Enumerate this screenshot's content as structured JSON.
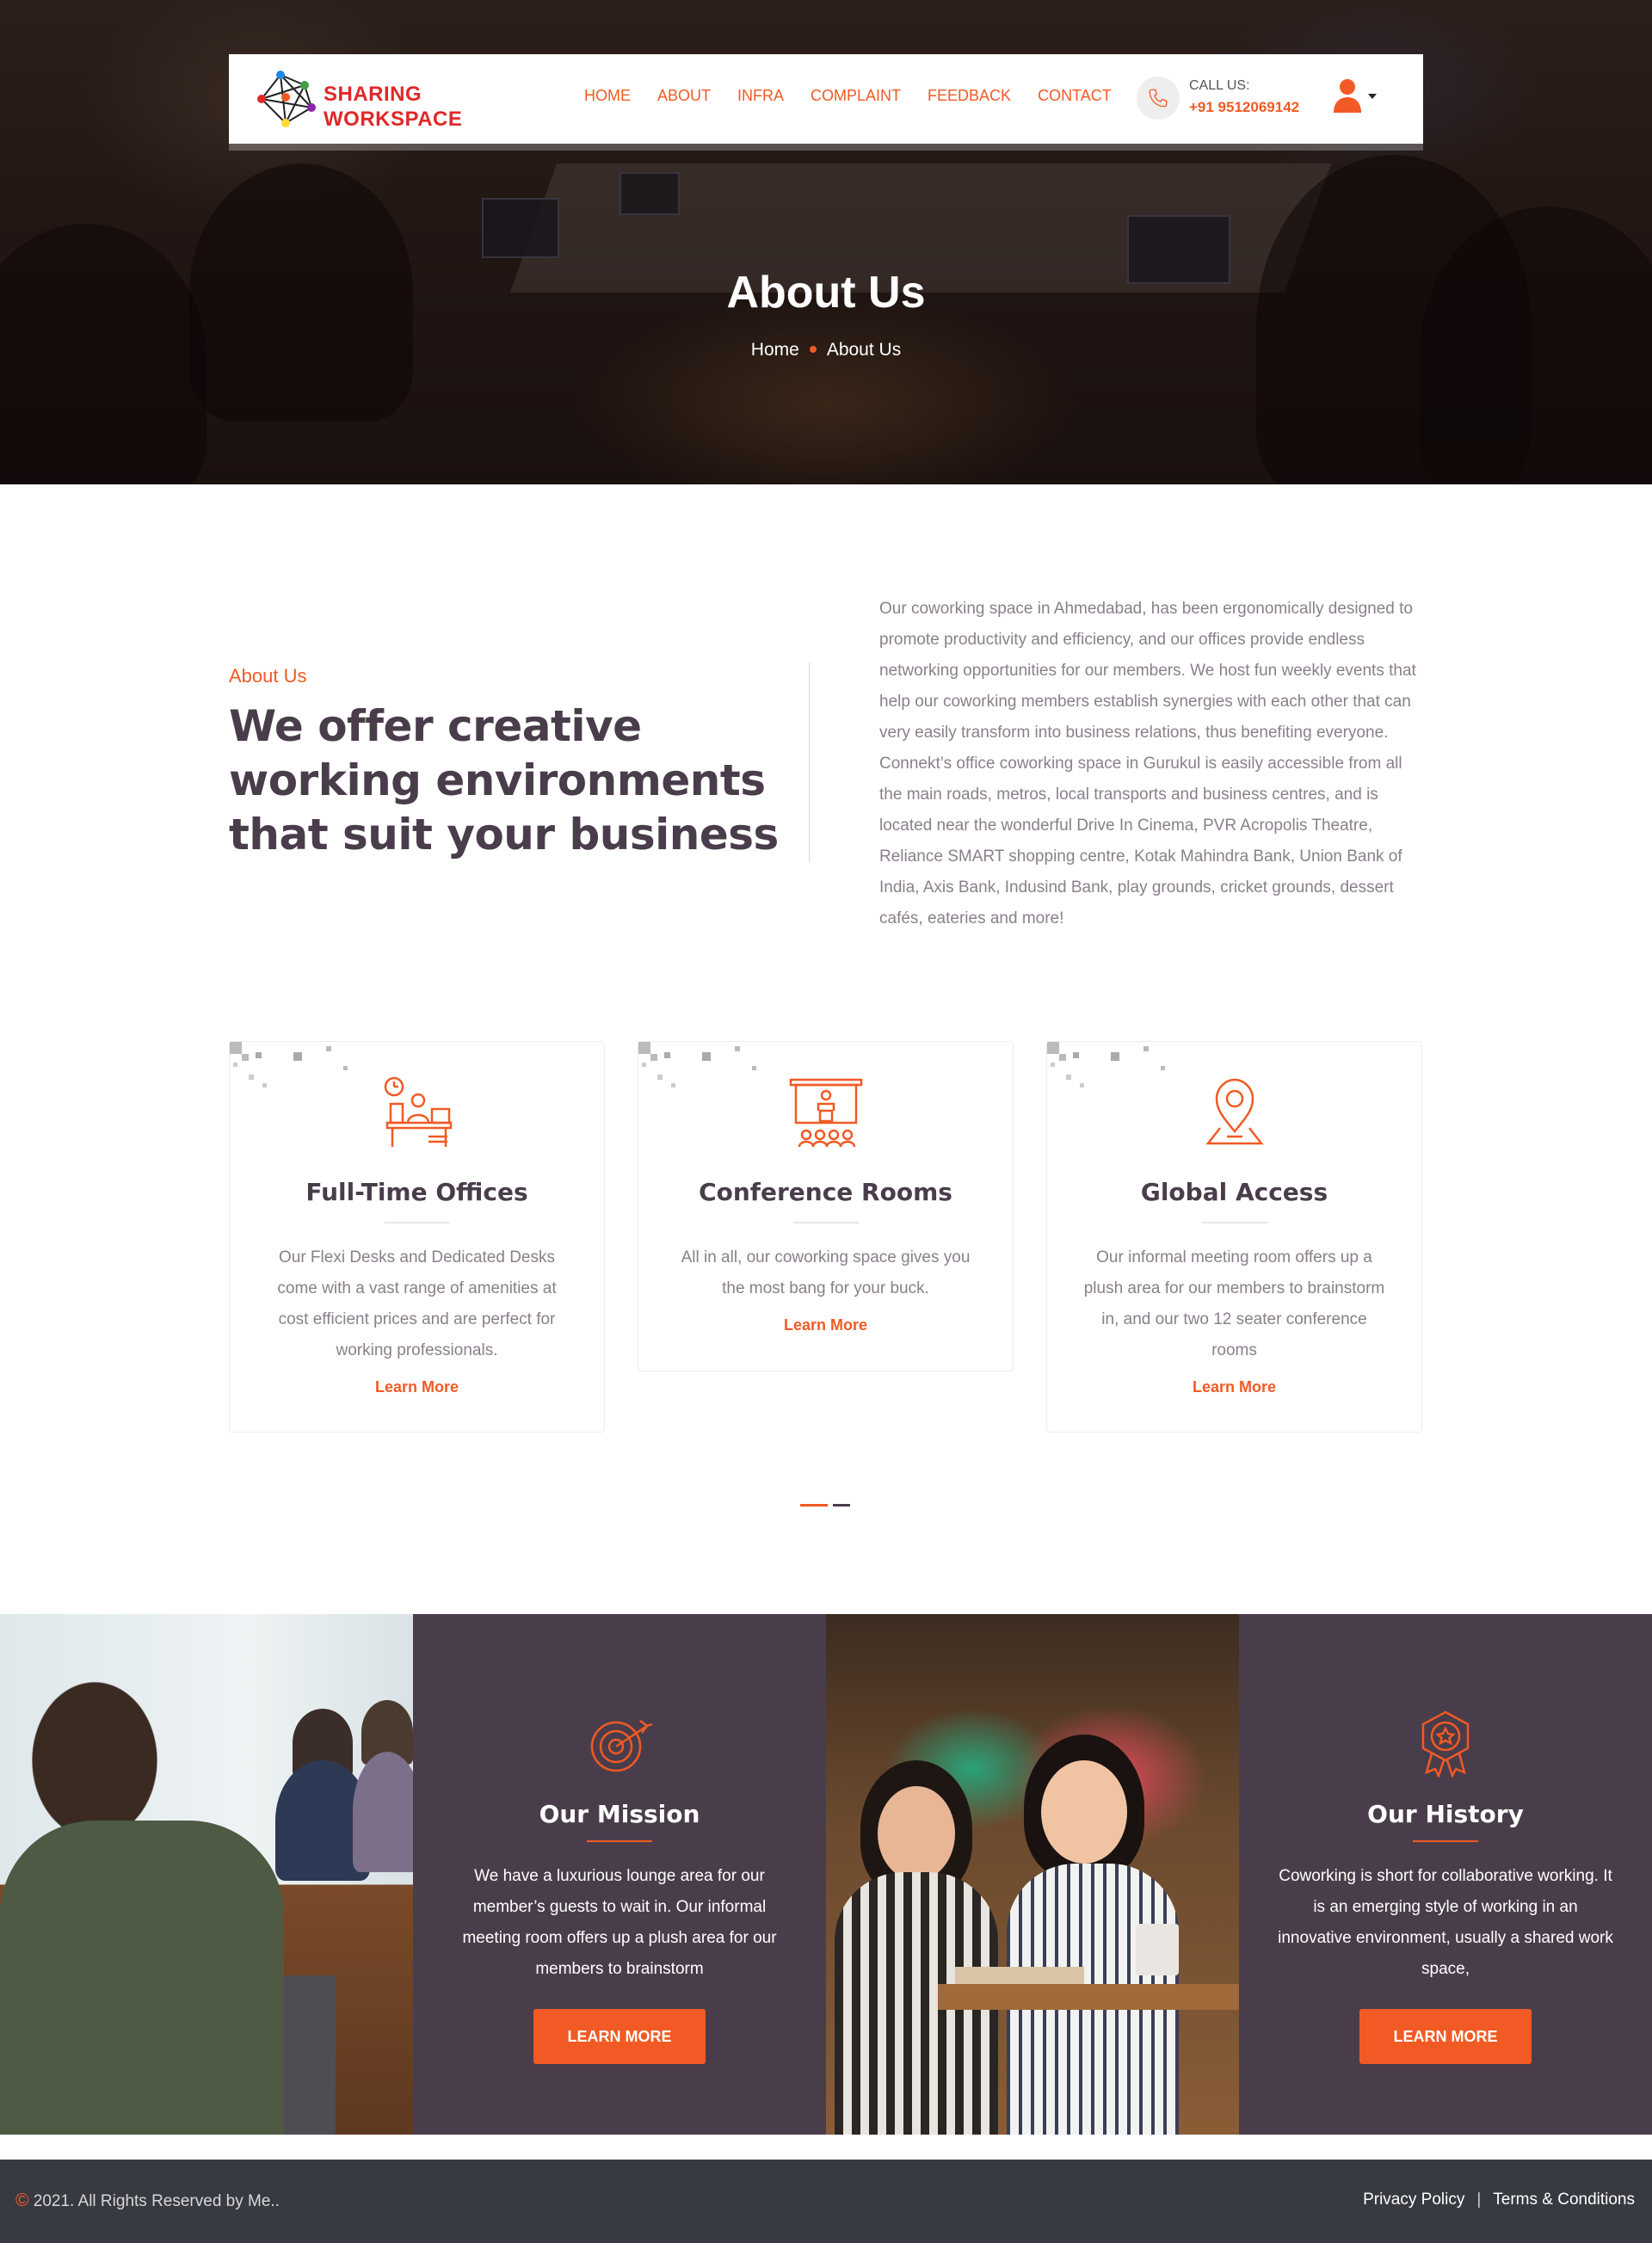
{
  "header": {
    "logo_line1": "SHARING",
    "logo_line2": "WORKSPACE",
    "nav": [
      "HOME",
      "ABOUT",
      "INFRA",
      "COMPLAINT",
      "FEEDBACK",
      "CONTACT"
    ],
    "call_label": "CALL US:",
    "call_number": "+91 9512069142"
  },
  "hero": {
    "title": "About Us",
    "breadcrumb_home": "Home",
    "breadcrumb_current": "About Us"
  },
  "about": {
    "eyebrow": "About Us",
    "heading": "We offer creative working environments that suit your business",
    "body": "Our coworking space in Ahmedabad, has been ergonomically designed to promote productivity and efficiency, and our offices provide endless networking opportunities for our members. We host fun weekly events that help our coworking members establish synergies with each other that can very easily transform into business relations, thus benefiting everyone. Connekt’s office coworking space in Gurukul is easily accessible from all the main roads, metros, local transports and business centres, and is located near the wonderful Drive In Cinema, PVR Acropolis Theatre, Reliance SMART shopping centre, Kotak Mahindra Bank, Union Bank of India, Axis Bank, Indusind Bank, play grounds, cricket grounds, dessert cafés, eateries and more!"
  },
  "services": [
    {
      "title": "Full-Time Offices",
      "desc": "Our Flexi Desks and Dedicated Desks come with a vast range of amenities at cost efficient prices and are perfect for working professionals.",
      "link": "Learn More",
      "icon": "office-desk-icon"
    },
    {
      "title": "Conference Rooms",
      "desc": "All in all, our coworking space gives you the most bang for your buck.",
      "link": "Learn More",
      "icon": "conference-podium-icon"
    },
    {
      "title": "Global Access",
      "desc": "Our informal meeting room offers up a plush area for our members to brainstorm in, and our two 12 seater conference rooms",
      "link": "Learn More",
      "icon": "map-pin-icon"
    }
  ],
  "mission": {
    "title": "Our Mission",
    "text": "We have a luxurious lounge area for our member’s guests to wait in. Our informal meeting room offers up a plush area for our members to brainstorm",
    "button": "LEARN MORE",
    "icon": "target-icon"
  },
  "history": {
    "title": "Our History",
    "text": "Coworking is short for collaborative working. It is an emerging style of working in an innovative environment, usually a shared work space,",
    "button": "LEARN MORE",
    "icon": "award-badge-icon"
  },
  "footer": {
    "copyright_symbol": "©",
    "copyright": " 2021. All Rights Reserved by Me..",
    "privacy": "Privacy Policy",
    "separator": "|",
    "terms": "Terms & Conditions"
  },
  "colors": {
    "accent": "#f15a24",
    "dark": "#4a3d4b",
    "footer": "#383a42"
  }
}
